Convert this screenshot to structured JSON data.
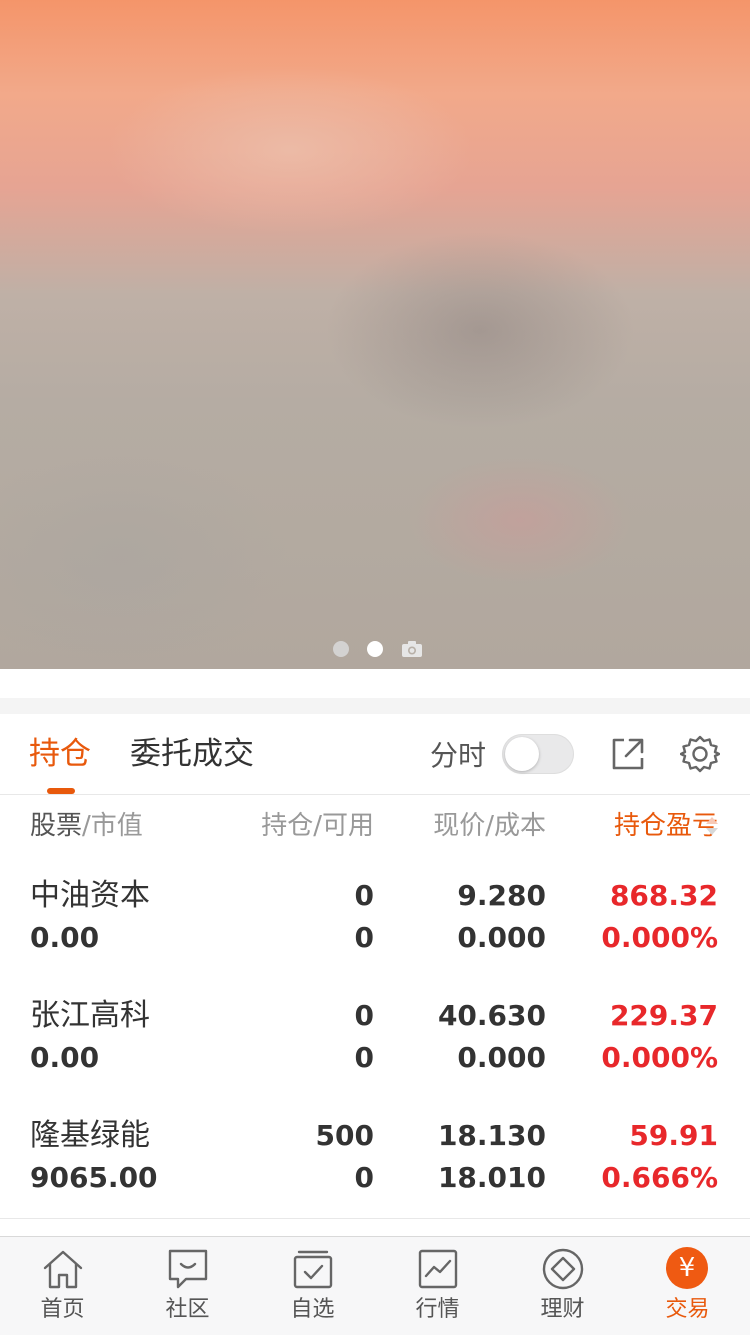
{
  "banner": {
    "dots": [
      {
        "state": "inactive"
      },
      {
        "state": "active"
      },
      {
        "state": "camera-icon"
      }
    ]
  },
  "tabs": {
    "items": [
      {
        "label": "持仓",
        "active": true
      },
      {
        "label": "委托成交",
        "active": false
      }
    ],
    "fenshi_label": "分时",
    "fenshi_toggle_on": false,
    "icons": [
      "share-icon",
      "gear-icon"
    ],
    "accent_color": "#e8590c"
  },
  "columns": {
    "stock": "股票",
    "market_value": "/市值",
    "hold": "持仓",
    "available": "/可用",
    "price": "现价",
    "cost": "/成本",
    "pnl": "持仓盈亏"
  },
  "holdings": [
    {
      "name": "中油资本",
      "market_value": "0.00",
      "hold": "0",
      "available": "0",
      "price": "9.280",
      "cost": "0.000",
      "pnl": "868.32",
      "pnl_pct": "0.000%"
    },
    {
      "name": "张江高科",
      "market_value": "0.00",
      "hold": "0",
      "available": "0",
      "price": "40.630",
      "cost": "0.000",
      "pnl": "229.37",
      "pnl_pct": "0.000%"
    },
    {
      "name": "隆基绿能",
      "market_value": "9065.00",
      "hold": "500",
      "available": "0",
      "price": "18.130",
      "cost": "18.010",
      "pnl": "59.91",
      "pnl_pct": "0.666%"
    }
  ],
  "colors": {
    "profit": "#e8282b",
    "accent": "#e8590c"
  },
  "bottom_nav": [
    {
      "label": "首页",
      "icon": "home-icon"
    },
    {
      "label": "社区",
      "icon": "community-icon"
    },
    {
      "label": "自选",
      "icon": "watchlist-icon"
    },
    {
      "label": "行情",
      "icon": "market-icon"
    },
    {
      "label": "理财",
      "icon": "finance-icon"
    },
    {
      "label": "交易",
      "icon": "trade-icon",
      "active": true,
      "badge_glyph": "¥"
    }
  ]
}
